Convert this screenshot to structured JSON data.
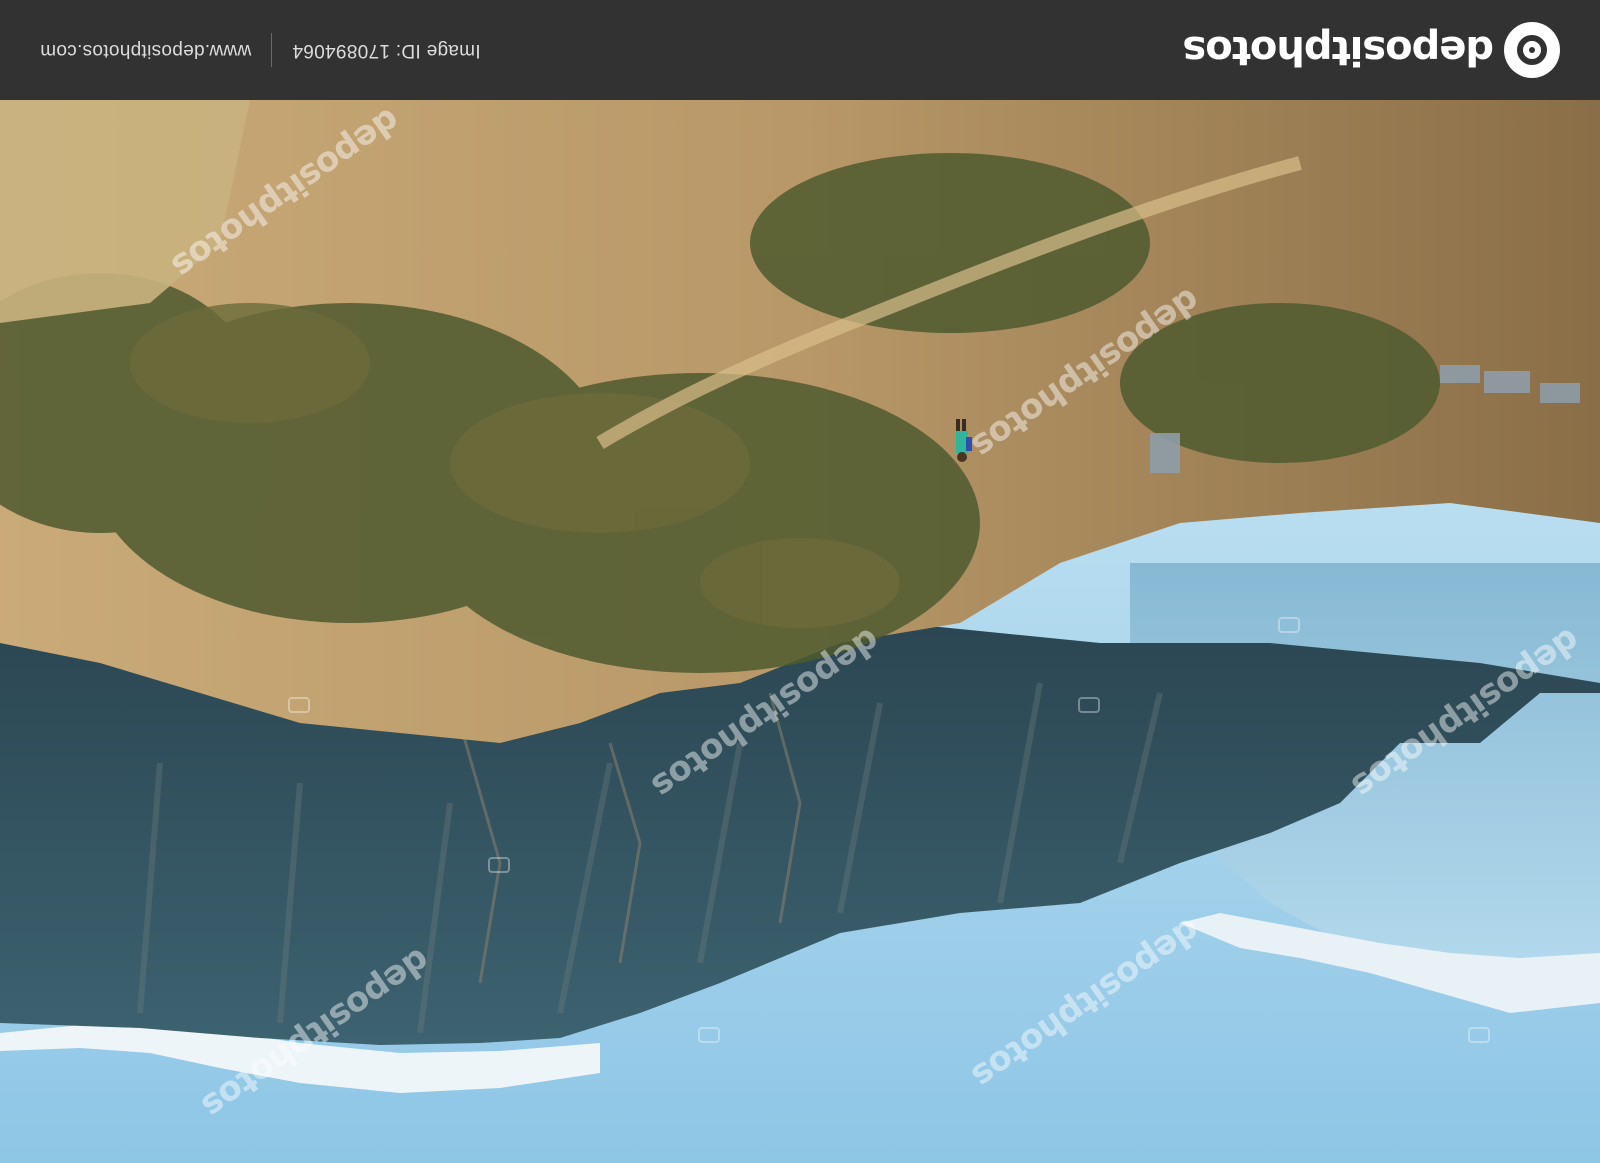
{
  "image": {
    "description_visible": "Mountain valley photo (displayed upside-down) with a stock-photo footer bar",
    "orientation": "rotated 180 degrees"
  },
  "footer": {
    "brand_name": "depositphotos",
    "image_id_label": "Image ID: 170894064",
    "site_url": "www.depositphotos.com"
  },
  "watermark": {
    "text": "depositphotos"
  },
  "colors": {
    "footer_bg": "#323232",
    "sky": "#a9d3ea",
    "mountain": "#2f4f5c",
    "hillside": "#a58a5c"
  }
}
